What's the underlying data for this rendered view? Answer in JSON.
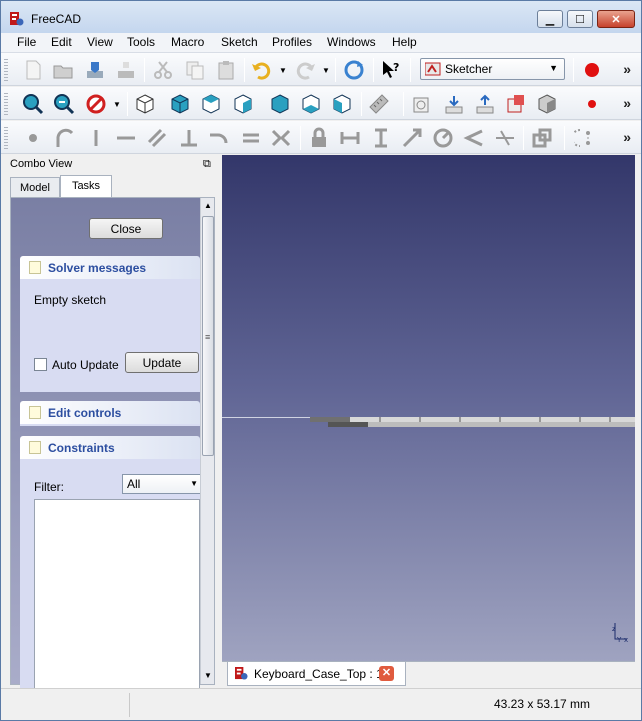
{
  "window": {
    "title": "FreeCAD",
    "minimize": "▁",
    "maximize": "☐",
    "close": "✕"
  },
  "menu": [
    "File",
    "Edit",
    "View",
    "Tools",
    "Macro",
    "Sketch",
    "Profiles",
    "Windows",
    "Help"
  ],
  "toolbar": {
    "workbench": "Sketcher",
    "more": "»"
  },
  "combo": {
    "title": "Combo View",
    "tabs": [
      "Model",
      "Tasks"
    ],
    "active_tab": "Tasks"
  },
  "tasks": {
    "close_label": "Close",
    "solver": {
      "title": "Solver messages",
      "message": "Empty sketch",
      "auto_update_label": "Auto Update",
      "auto_update_checked": false,
      "update_label": "Update"
    },
    "edit_controls": {
      "title": "Edit controls"
    },
    "constraints": {
      "title": "Constraints",
      "filter_label": "Filter:",
      "filter_value": "All"
    }
  },
  "document_tab": {
    "label": "Keyboard_Case_Top : 1*"
  },
  "status": {
    "dimensions": "43.23 x 53.17 mm"
  },
  "icons": [
    "new-icon",
    "open-icon",
    "save-icon",
    "export-icon",
    "cut-icon",
    "copy-icon",
    "paste-icon",
    "undo-icon",
    "redo-icon",
    "refresh-icon",
    "whats-this-icon",
    "record-macro-icon",
    "fit-all-icon",
    "fit-selection-icon",
    "draw-style-icon",
    "isometric-view-icon",
    "front-view-icon",
    "top-view-icon",
    "right-view-icon",
    "rear-view-icon",
    "bottom-view-icon",
    "left-view-icon",
    "measure-icon",
    "sketch-new-icon",
    "leave-sketch-icon",
    "view-sketch-icon",
    "map-sketch-icon",
    "validate-sketch-icon",
    "point-icon",
    "arc-icon",
    "line-icon",
    "constrain-horizontal-icon",
    "constrain-parallel-icon",
    "constrain-perpendicular-icon",
    "constrain-tangent-icon",
    "constrain-equal-icon",
    "constrain-symmetric-icon",
    "constrain-lock-icon",
    "constrain-distance-x-icon",
    "constrain-distance-y-icon",
    "constrain-distance-icon",
    "constrain-radius-icon",
    "constrain-angle-icon",
    "constrain-snell-icon",
    "toggle-construction-icon",
    "select-constraints-icon"
  ],
  "colors": {
    "view_top": "#33376a",
    "view_bottom": "#9fa3c0",
    "panel_title": "#2c4ea0",
    "record": "#e01010"
  }
}
